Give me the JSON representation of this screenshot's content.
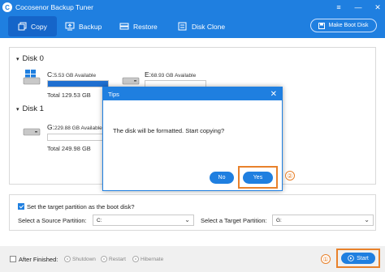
{
  "app": {
    "title": "Cocosenor Backup Tuner",
    "logo": "C"
  },
  "window_controls": [
    "≡",
    "—",
    "✕"
  ],
  "toolbar": {
    "tabs": [
      {
        "label": "Copy",
        "icon": "copy-icon"
      },
      {
        "label": "Backup",
        "icon": "backup-icon"
      },
      {
        "label": "Restore",
        "icon": "restore-icon"
      },
      {
        "label": "Disk Clone",
        "icon": "disk-clone-icon"
      }
    ],
    "make_boot_disk": "Make Boot Disk"
  },
  "disks": [
    {
      "label": "Disk 0",
      "partitions": [
        {
          "name": "C:",
          "size": "5.53 GB Available",
          "used_fraction": 1.0
        },
        {
          "name": "E:",
          "size": "68.93 GB Available",
          "used_fraction": 0.0
        }
      ],
      "total": "Total 129.53 GB"
    },
    {
      "label": "Disk 1",
      "partitions": [
        {
          "name": "G:",
          "size": "229.88 GB Available",
          "used_fraction": 0.0
        }
      ],
      "total": "Total 249.98 GB"
    }
  ],
  "dialog": {
    "title": "Tips",
    "message": "The disk will be formatted. Start copying?",
    "no_label": "No",
    "yes_label": "Yes",
    "yes_marker": "②"
  },
  "options": {
    "boot_checkbox_label": "Set the target partition as the boot disk?",
    "boot_checked": true,
    "source_label": "Select a Source Partition:",
    "source_value": "C:",
    "target_label": "Select a Target Partition:",
    "target_value": "G:"
  },
  "bottom": {
    "after_finished": "After Finished:",
    "after_finished_checked": false,
    "radios": [
      "Shutdown",
      "Restart",
      "Hibernate"
    ],
    "start_label": "Start",
    "start_marker": "①"
  },
  "colors": {
    "accent": "#1f7fe0",
    "highlight": "#e8812b"
  }
}
